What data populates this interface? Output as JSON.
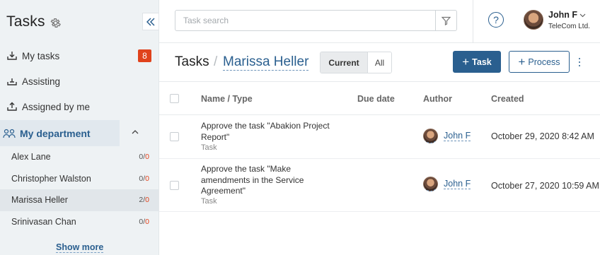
{
  "sidebar": {
    "title": "Tasks",
    "menu": [
      {
        "label": "My tasks",
        "badge": "8"
      },
      {
        "label": "Assisting"
      },
      {
        "label": "Assigned by me"
      }
    ],
    "department": "My department",
    "employees": [
      {
        "name": "Alex Lane",
        "count_a": "0/",
        "count_b": "0"
      },
      {
        "name": "Christopher Walston",
        "count_a": "0/",
        "count_b": "0"
      },
      {
        "name": "Marissa Heller",
        "count_a": "2/",
        "count_b": "0"
      },
      {
        "name": "Srinivasan Chan",
        "count_a": "0/",
        "count_b": "0"
      }
    ],
    "show_more": "Show more"
  },
  "topbar": {
    "search_placeholder": "Task search",
    "help": "?",
    "user_name": "John F",
    "user_company": "TeleCom Ltd."
  },
  "header": {
    "section": "Tasks",
    "separator": "/",
    "person": "Marissa Heller",
    "tab_current": "Current",
    "tab_all": "All",
    "task_button": "Task",
    "process_button": "Process"
  },
  "table": {
    "columns": {
      "name": "Name / Type",
      "due": "Due date",
      "author": "Author",
      "created": "Created"
    },
    "rows": [
      {
        "title": "Approve the task \"Abakion Project Report\"",
        "type": "Task",
        "author": "John F",
        "created": "October 29, 2020 8:42 AM"
      },
      {
        "title": "Approve the task \"Make amendments in the Service Agreement\"",
        "type": "Task",
        "author": "John F",
        "created": "October 27, 2020 10:59 AM"
      }
    ]
  },
  "colors": {
    "accent": "#2a5f8f",
    "badge": "#e0421b",
    "sidebar_bg": "#eef2f4"
  }
}
